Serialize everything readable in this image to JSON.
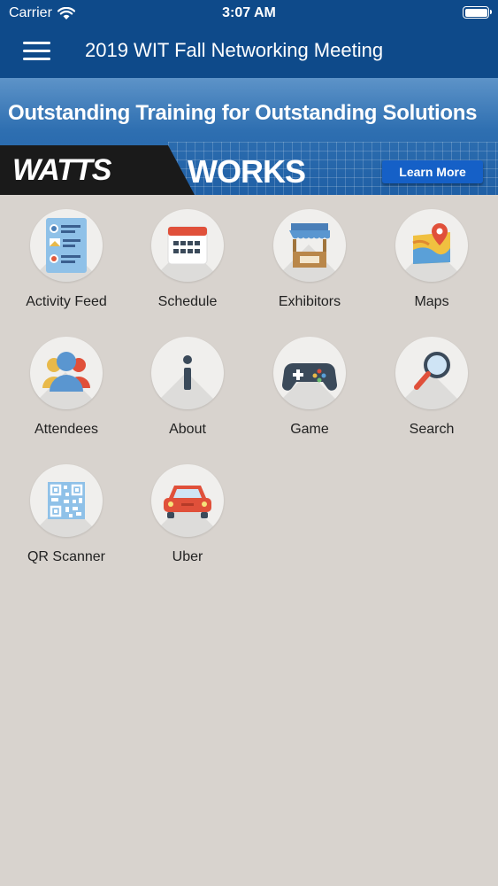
{
  "status_bar": {
    "carrier": "Carrier",
    "time": "3:07 AM"
  },
  "header": {
    "title": "2019 WIT Fall Networking Meeting",
    "menu_icon": "hamburger-menu-icon"
  },
  "banner": {
    "slogan": "Outstanding Training for Outstanding Solutions",
    "brand_left": "WATTS",
    "brand_right": "WORKS",
    "cta": "Learn More"
  },
  "tiles": [
    {
      "label": "Activity Feed",
      "icon": "activity-feed-icon"
    },
    {
      "label": "Schedule",
      "icon": "calendar-icon"
    },
    {
      "label": "Exhibitors",
      "icon": "booth-icon"
    },
    {
      "label": "Maps",
      "icon": "map-pin-icon"
    },
    {
      "label": "Attendees",
      "icon": "people-icon"
    },
    {
      "label": "About",
      "icon": "info-icon"
    },
    {
      "label": "Game",
      "icon": "gamepad-icon"
    },
    {
      "label": "Search",
      "icon": "magnifier-icon"
    },
    {
      "label": "QR Scanner",
      "icon": "qr-code-icon"
    },
    {
      "label": "Uber",
      "icon": "car-icon"
    }
  ]
}
